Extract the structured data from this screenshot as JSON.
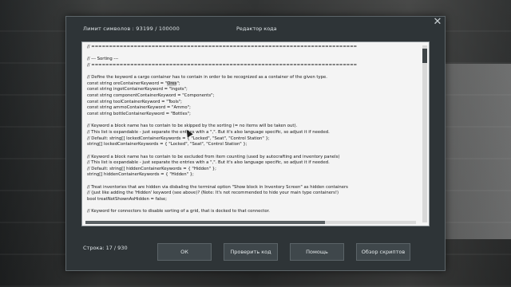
{
  "dialog": {
    "char_limit": "Лимит символов : 93199 / 100000",
    "title": "Редактор кода",
    "close_glyph": "✕",
    "line_counter": "Строка: 17 / 930"
  },
  "editor": {
    "lines": [
      {
        "text": "// ==========================================================================="
      },
      {
        "text": ""
      },
      {
        "text": "// --- Sorting ---"
      },
      {
        "text": "// ==========================================================================="
      },
      {
        "text": ""
      },
      {
        "text": "// Define the keyword a cargo container has to contain in order to be recognized as a container of the given type."
      },
      {
        "pre": "const string oreContainerKeyword = \"",
        "hl": "Ores",
        "post": "\";"
      },
      {
        "text": "const string ingotContainerKeyword = \"Ingots\";"
      },
      {
        "text": "const string componentContainerKeyword = \"Components\";"
      },
      {
        "text": "const string toolContainerKeyword = \"Tools\";"
      },
      {
        "text": "const string ammoContainerKeyword = \"Ammo\";"
      },
      {
        "text": "const string bottleContainerKeyword = \"Bottles\";"
      },
      {
        "text": ""
      },
      {
        "text": "// Keyword a block name has to contain to be skipped by the sorting (= no items will be taken out)."
      },
      {
        "text": "// This list is expandable - just separate the entries with a \",\". But it's also language specific, so adjust it if needed."
      },
      {
        "text": "// Default: string[] lockedContainerKeywords = { \"Locked\", \"Seat\", \"Control Station\" };"
      },
      {
        "text": "string[] lockedContainerKeywords = { \"Locked\", \"Seat\", \"Control Station\" };"
      },
      {
        "text": ""
      },
      {
        "text": "// Keyword a block name has to contain to be excluded from item counting (used by autocrafting and inventory panels)"
      },
      {
        "text": "// This list is expandable - just separate the entries with a \",\". But it's also language specific, so adjust it if needed."
      },
      {
        "text": "// Default: string[] hiddenContainerKeywords = { \"Hidden\" };"
      },
      {
        "text": "string[] hiddenContainerKeywords = { \"Hidden\" };"
      },
      {
        "text": ""
      },
      {
        "text": "// Treat inventories that are hidden via disbaling the terminal option \"Show block in Inventory Screen\" as hidden containers"
      },
      {
        "text": "// (just like adding the 'Hidden' keyword (see above)? (Note: It's not recommended to hide your main type containers!)"
      },
      {
        "text": "bool treatNotShownAsHidden = false;"
      },
      {
        "text": ""
      },
      {
        "text": "// Keyword for connectors to disable sorting of a grid, that is docked to that connector."
      }
    ]
  },
  "buttons": {
    "ok": "ОК",
    "check": "Проверить код",
    "help": "Помощь",
    "browse": "Обзор скриптов"
  }
}
